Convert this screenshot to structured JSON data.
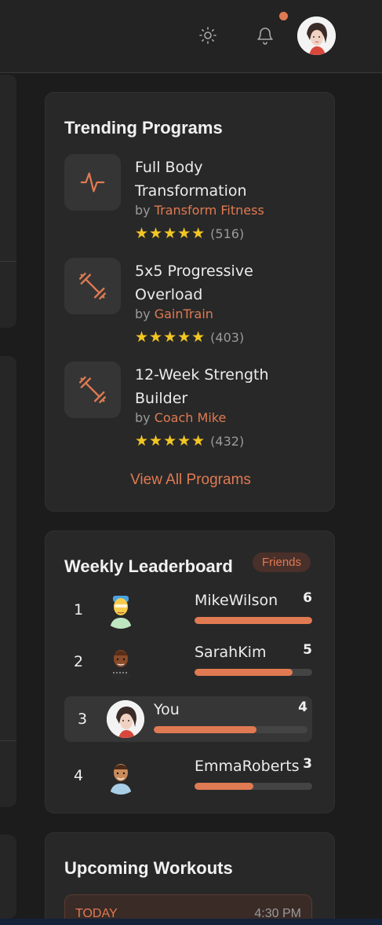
{
  "colors": {
    "accent": "#e07a52",
    "star": "#f3c623",
    "card": "#282828",
    "background": "#1c1c1c"
  },
  "header": {
    "icons": [
      "sun-icon",
      "bell-icon"
    ],
    "has_notification": true
  },
  "trending": {
    "title": "Trending Programs",
    "programs": [
      {
        "name": "Full Body Transformation",
        "by": "by",
        "author": "Transform Fitness",
        "stars": "★★★★★",
        "count": "(516)",
        "icon": "activity-icon"
      },
      {
        "name": "5x5 Progressive Overload",
        "by": "by",
        "author": "GainTrain",
        "stars": "★★★★★",
        "count": "(403)",
        "icon": "dumbbell-icon"
      },
      {
        "name": "12-Week Strength Builder",
        "by": "by",
        "author": "Coach Mike",
        "stars": "★★★★★",
        "count": "(432)",
        "icon": "dumbbell-icon"
      }
    ],
    "view_all": "View All Programs"
  },
  "leaderboard": {
    "title": "Weekly Leaderboard",
    "filter": "Friends",
    "rows": [
      {
        "rank": "1",
        "name": "MikeWilson",
        "score": "6",
        "progress": 1.0
      },
      {
        "rank": "2",
        "name": "SarahKim",
        "score": "5",
        "progress": 0.833
      },
      {
        "rank": "3",
        "name": "You",
        "score": "4",
        "progress": 0.667
      },
      {
        "rank": "4",
        "name": "EmmaRoberts",
        "score": "3",
        "progress": 0.5
      }
    ]
  },
  "upcoming": {
    "title": "Upcoming Workouts",
    "items": [
      {
        "label": "TODAY",
        "time": "4:30 PM"
      }
    ]
  }
}
